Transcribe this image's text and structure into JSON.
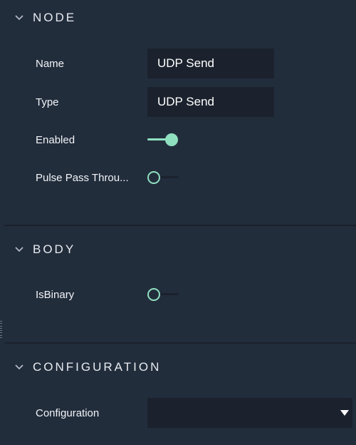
{
  "sections": {
    "node": {
      "title": "NODE",
      "fields": {
        "name_label": "Name",
        "name_value": "UDP Send",
        "type_label": "Type",
        "type_value": "UDP Send",
        "enabled_label": "Enabled",
        "enabled_state": true,
        "pulse_label": "Pulse Pass Throu...",
        "pulse_state": false
      }
    },
    "body": {
      "title": "BODY",
      "fields": {
        "isbinary_label": "IsBinary",
        "isbinary_state": false
      }
    },
    "configuration": {
      "title": "CONFIGURATION",
      "fields": {
        "configuration_label": "Configuration",
        "configuration_value": ""
      }
    }
  },
  "colors": {
    "background": "#222d3c",
    "field_background": "#1b222d",
    "accent": "#8fe0c0"
  },
  "icons": {
    "section_toggle": "chevron-down-icon",
    "select_arrow": "triangle-down-icon"
  }
}
